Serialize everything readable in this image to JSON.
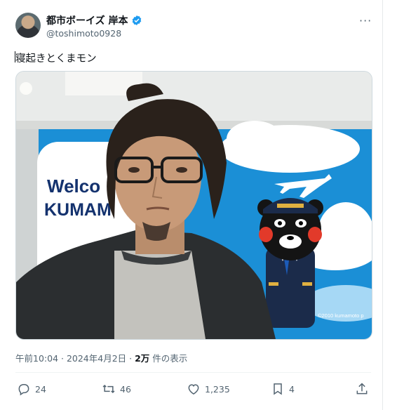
{
  "author": {
    "display_name": "都市ボーイズ 岸本",
    "handle": "@toshimoto0928",
    "verified": true,
    "avatar": "avatar"
  },
  "tweet": {
    "text": "寝起きとくまモン",
    "image": {
      "sign_text_line1": "Welco",
      "sign_text_line2": "KUMAM",
      "copyright": "©2010 kumamoto p"
    },
    "timestamp": "午前10:04 · 2024年4月2日",
    "views_count": "2万",
    "views_label": "件の表示"
  },
  "actions": {
    "reply": {
      "icon": "reply-icon",
      "count": "24"
    },
    "retweet": {
      "icon": "retweet-icon",
      "count": "46"
    },
    "like": {
      "icon": "heart-icon",
      "count": "1,235"
    },
    "bookmark": {
      "icon": "bookmark-icon",
      "count": "4"
    },
    "share": {
      "icon": "share-icon"
    }
  },
  "colors": {
    "verified": "#1d9bf0",
    "muted": "#536471",
    "text": "#0f1419",
    "wall_blue": "#1b8fd6"
  }
}
